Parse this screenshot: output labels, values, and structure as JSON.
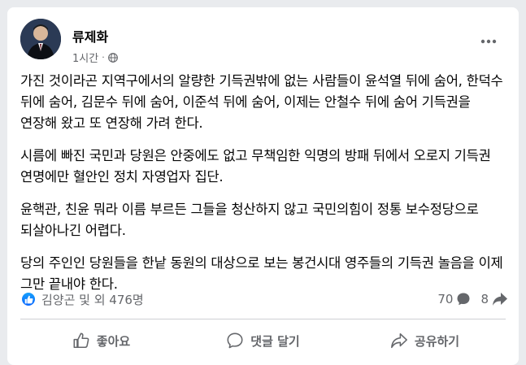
{
  "post": {
    "author": "류제화",
    "timestamp": "1시간",
    "visibility_icon": "globe-icon",
    "paragraphs": [
      "가진 것이라곤 지역구에서의 알량한 기득권밖에 없는 사람들이 윤석열 뒤에 숨어, 한덕수 뒤에 숨어, 김문수 뒤에 숨어, 이준석 뒤에 숨어, 이제는 안철수 뒤에 숨어 기득권을 연장해 왔고 또 연장해 가려 한다.",
      "시름에 빠진 국민과 당원은 안중에도 없고 무책임한 익명의 방패 뒤에서 오로지 기득권 연명에만 혈안인 정치 자영업자 집단.",
      "윤핵관, 친윤 뭐라 이름 부르든 그들을 청산하지 않고 국민의힘이 정통 보수정당으로 되살아나긴 어렵다.",
      "당의 주인인 당원들을 한낱 동원의 대상으로 보는 봉건시대 영주들의 기득권 놀음을 이제 그만 끝내야 한다."
    ]
  },
  "stats": {
    "reactions_text": "김양곤 및 외 476명",
    "comments_count": "70",
    "shares_count": "8"
  },
  "actions": {
    "like_label": "좋아요",
    "comment_label": "댓글 달기",
    "share_label": "공유하기"
  },
  "colors": {
    "accent": "#0866ff",
    "secondary_text": "#65676b",
    "background": "#e9ebee"
  }
}
